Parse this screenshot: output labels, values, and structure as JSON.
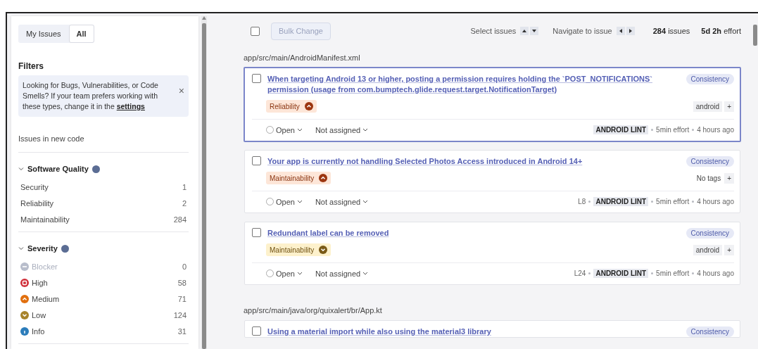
{
  "scope_tabs": [
    {
      "label": "My Issues",
      "selected": false
    },
    {
      "label": "All",
      "selected": true
    }
  ],
  "filters": {
    "title": "Filters",
    "notice": {
      "text": "Looking for Bugs, Vulnerabilities, or Code Smells? If your team prefers working with these types, change it in the ",
      "link": "settings",
      "close": "×"
    },
    "new_code": "Issues in new code",
    "sections": [
      {
        "title": "Software Quality",
        "expanded": true,
        "items": [
          {
            "label": "Security",
            "count": "1"
          },
          {
            "label": "Reliability",
            "count": "2"
          },
          {
            "label": "Maintainability",
            "count": "284"
          }
        ]
      },
      {
        "title": "Severity",
        "expanded": true,
        "items": [
          {
            "label": "Blocker",
            "count": "0",
            "kind": "blocker",
            "color": "#b8bdcb",
            "disabled": true
          },
          {
            "label": "High",
            "count": "58",
            "kind": "high",
            "color": "#d02f3a",
            "disabled": false
          },
          {
            "label": "Medium",
            "count": "71",
            "kind": "medium",
            "color": "#e16f0e",
            "disabled": false
          },
          {
            "label": "Low",
            "count": "124",
            "kind": "low",
            "color": "#a7832b",
            "disabled": false
          },
          {
            "label": "Info",
            "count": "31",
            "kind": "info",
            "color": "#2c7dbb",
            "disabled": false
          }
        ]
      }
    ]
  },
  "toolbar": {
    "select_all_checked": false,
    "bulk_change": "Bulk Change",
    "bulk_disabled": true,
    "select_label": "Select issues",
    "navigate_label": "Navigate to issue",
    "issues_count": "284",
    "issues_label": "issues",
    "effort_value": "5d 2h",
    "effort_label": "effort"
  },
  "groups": [
    {
      "path": "app/src/main/AndroidManifest.xml",
      "issues": [
        {
          "title": "When targeting Android 13 or higher, posting a permission requires holding the `POST_NOTIFICATIONS` permission (usage from com.bumptech.glide.request.target.NotificationTarget)",
          "selected": true,
          "checked": false,
          "attribute": "Consistency",
          "quality": "Reliability",
          "kind": "medium",
          "tags": [
            "android"
          ],
          "tags_add": "+",
          "status": "Open",
          "assignee": "Not assigned",
          "engine": "ANDROID LINT",
          "effort": "5min effort",
          "age": "4 hours ago"
        },
        {
          "title": "Your app is currently not handling Selected Photos Access introduced in Android 14+",
          "selected": false,
          "checked": false,
          "attribute": "Consistency",
          "quality": "Maintainability",
          "kind": "medium",
          "no_tags": "No tags",
          "tags_add": "+",
          "status": "Open",
          "assignee": "Not assigned",
          "line": "L8",
          "engine": "ANDROID LINT",
          "effort": "5min effort",
          "age": "4 hours ago"
        },
        {
          "title": "Redundant label can be removed",
          "selected": false,
          "checked": false,
          "attribute": "Consistency",
          "quality": "Maintainability",
          "kind": "low",
          "tags": [
            "android"
          ],
          "tags_add": "+",
          "status": "Open",
          "assignee": "Not assigned",
          "line": "L24",
          "engine": "ANDROID LINT",
          "effort": "5min effort",
          "age": "4 hours ago"
        }
      ]
    },
    {
      "path": "app/src/main/java/org/quixalert/br/App.kt",
      "issues": [
        {
          "title": "Using a material import while also using the material3 library",
          "selected": false,
          "checked": false,
          "attribute": "Consistency"
        }
      ]
    }
  ]
}
